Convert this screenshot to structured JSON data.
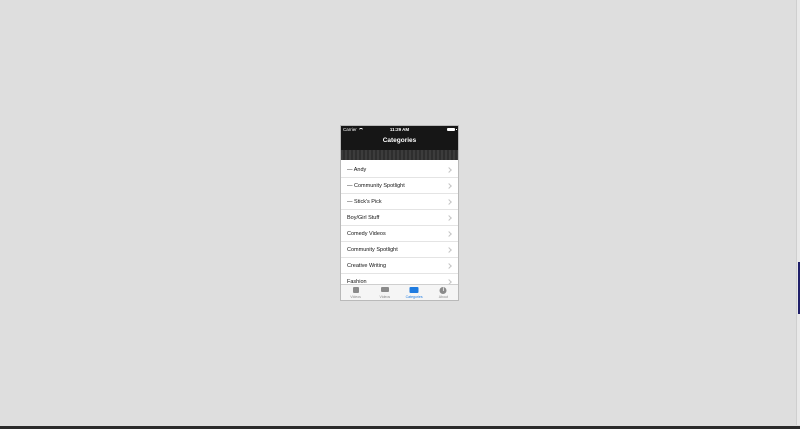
{
  "status_bar": {
    "carrier": "Carrier",
    "time": "11:29 AM"
  },
  "nav": {
    "title": "Categories"
  },
  "categories": [
    {
      "label": "— Andy"
    },
    {
      "label": "— Community Spotlight"
    },
    {
      "label": "— Stick's Pick"
    },
    {
      "label": "Boy/Girl Stuff"
    },
    {
      "label": "Comedy Videos"
    },
    {
      "label": "Community Spotlight"
    },
    {
      "label": "Creative Writing"
    },
    {
      "label": "Fashion"
    }
  ],
  "tabs": [
    {
      "label": "Videos",
      "icon": "book-icon",
      "active": false
    },
    {
      "label": "Videos",
      "icon": "speech-bubble-icon",
      "active": false
    },
    {
      "label": "Categories",
      "icon": "folder-icon",
      "active": true
    },
    {
      "label": "About",
      "icon": "info-icon",
      "active": false
    }
  ],
  "colors": {
    "accent": "#1e7be0",
    "nav_background": "#161616",
    "page_background": "#dedede"
  }
}
